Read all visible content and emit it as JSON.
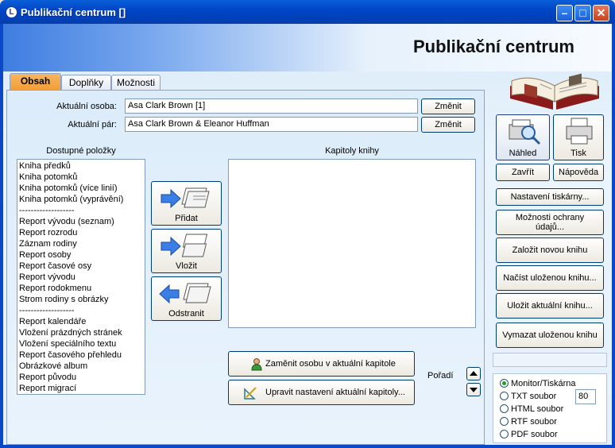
{
  "window": {
    "title": "Publikační centrum []"
  },
  "header": {
    "title": "Publikační centrum"
  },
  "tabs": [
    {
      "label": "Obsah",
      "active": true
    },
    {
      "label": "Doplňky",
      "active": false
    },
    {
      "label": "Možnosti",
      "active": false
    }
  ],
  "person": {
    "label": "Aktuální osoba:",
    "value": "Asa Clark Brown [1]",
    "change_label": "Změnit"
  },
  "couple": {
    "label": "Aktuální pár:",
    "value": "Asa Clark Brown & Eleanor Huffman",
    "change_label": "Změnit"
  },
  "available": {
    "caption": "Dostupné položky",
    "items": [
      "Kniha předků",
      "Kniha potomků",
      "Kniha potomků (více linií)",
      "Kniha potomků (vyprávění)",
      "-------------------",
      "Report vývodu (seznam)",
      "Report rozrodu",
      "Záznam rodiny",
      "Report osoby",
      "Report časové osy",
      "Report vývodu",
      "Report rodokmenu",
      "Strom rodiny s obrázky",
      "-------------------",
      "Report kalendáře",
      "Vložení prázdných stránek",
      "Vložení speciálního textu",
      "Report časového přehledu",
      "Obrázkové album",
      "Report původu",
      "Report migrací"
    ]
  },
  "chapters": {
    "caption": "Kapitoly knihy"
  },
  "actions": {
    "add": "Přidat",
    "insert": "Vložit",
    "remove": "Odstranit",
    "change_person_chapter": "Zaměnit osobu v aktuální kapitole",
    "edit_chapter_settings": "Upravit nastavení aktuální kapitoly...",
    "order_label": "Pořadí"
  },
  "side": {
    "preview": "Náhled",
    "print": "Tisk",
    "close": "Zavřít",
    "help": "Nápověda",
    "printer_settings": "Nastavení tiskárny...",
    "privacy": "Možnosti ochrany údajů...",
    "new_book": "Založit novou knihu",
    "load_book": "Načíst uloženou knihu...",
    "save_book": "Uložit aktuální knihu...",
    "delete_book": "Vymazat uloženou knihu"
  },
  "output": {
    "options": [
      {
        "label": "Monitor/Tiskárna",
        "selected": true
      },
      {
        "label": "TXT soubor",
        "selected": false
      },
      {
        "label": "HTML soubor",
        "selected": false
      },
      {
        "label": "RTF soubor",
        "selected": false
      },
      {
        "label": "PDF soubor",
        "selected": false
      }
    ],
    "txt_width": "80"
  },
  "colors": {
    "accent_tab": "#f29d36",
    "title_bar": "#0046c7",
    "frame": "#0a48c8"
  }
}
